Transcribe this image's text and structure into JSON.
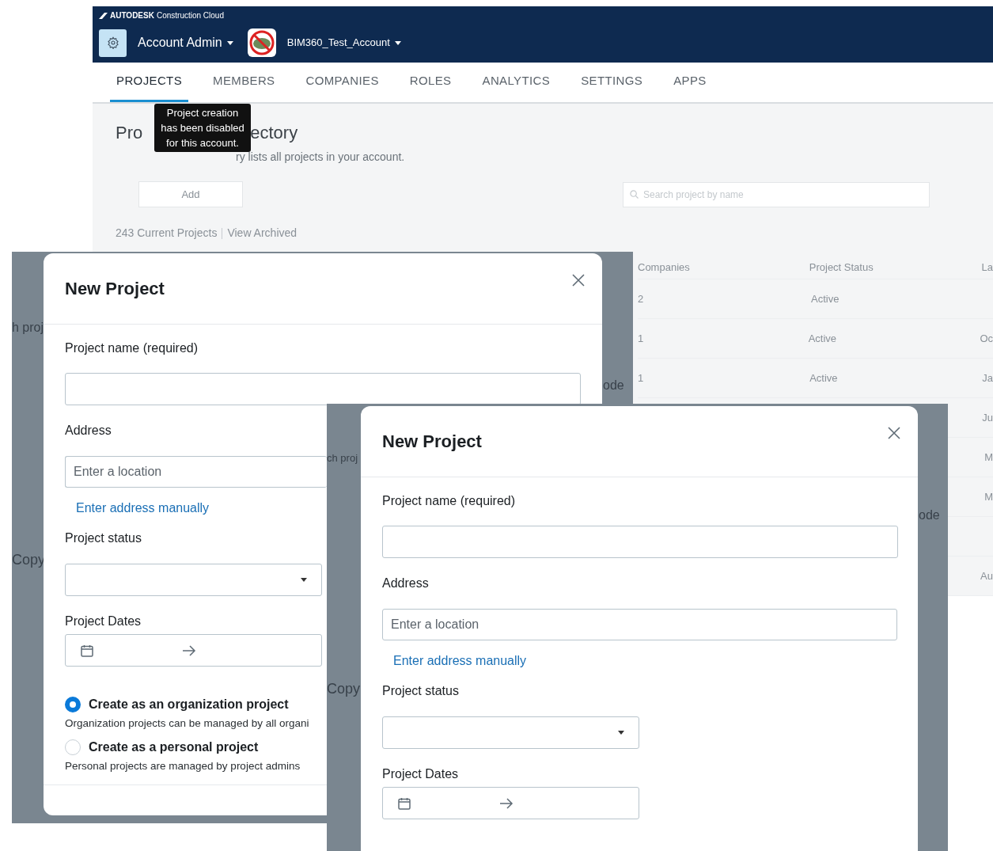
{
  "app": {
    "brand": {
      "logo": "AUTODESK",
      "product": "Construction Cloud"
    },
    "header": {
      "module": "Account Admin",
      "account": "BIM360_Test_Account"
    },
    "tabs": [
      {
        "label": "PROJECTS",
        "selected": true
      },
      {
        "label": "MEMBERS",
        "selected": false
      },
      {
        "label": "COMPANIES",
        "selected": false
      },
      {
        "label": "ROLES",
        "selected": false
      },
      {
        "label": "ANALYTICS",
        "selected": false
      },
      {
        "label": "SETTINGS",
        "selected": false
      },
      {
        "label": "APPS",
        "selected": false
      }
    ],
    "tooltip": "Project creation has been disabled for this account.",
    "page": {
      "title_parts": [
        "Pro",
        "ectory"
      ],
      "description": "ry lists all projects in your account.",
      "add_button": "Add",
      "search": {
        "placeholder": "Search project by name"
      },
      "count": "243 Current Projects",
      "archived_link": "View Archived",
      "table": {
        "columns": [
          "Companies",
          "Project Status",
          "La"
        ],
        "rows": [
          [
            "2",
            "Active",
            ""
          ],
          [
            "1",
            "Active",
            "Oc"
          ],
          [
            "1",
            "Active",
            "Ja"
          ],
          [
            "",
            "",
            "Ju"
          ],
          [
            "",
            "",
            "M"
          ],
          [
            "",
            "",
            "M"
          ],
          [
            "",
            "",
            ""
          ],
          [
            "",
            "",
            "Au"
          ]
        ]
      }
    }
  },
  "left_modal": {
    "backdrop_texts": [
      "h proj",
      "ode",
      "Copy"
    ],
    "title": "New Project",
    "name_label": "Project name (required)",
    "address_label": "Address",
    "address_placeholder": "Enter a location",
    "address_link": "Enter address manually",
    "status_label": "Project status",
    "dates_label": "Project Dates",
    "radios": [
      {
        "label": "Create as an organization project",
        "description": "Organization projects can be managed by all organi",
        "selected": true
      },
      {
        "label": "Create as a personal project",
        "description": "Personal projects are managed by project admins",
        "selected": false
      }
    ]
  },
  "right_modal": {
    "backdrop_texts": [
      "ch proj",
      "ode",
      "Copy"
    ],
    "title": "New Project",
    "name_label": "Project name (required)",
    "address_label": "Address",
    "address_placeholder": "Enter a location",
    "address_link": "Enter address manually",
    "status_label": "Project status",
    "dates_label": "Project Dates"
  }
}
